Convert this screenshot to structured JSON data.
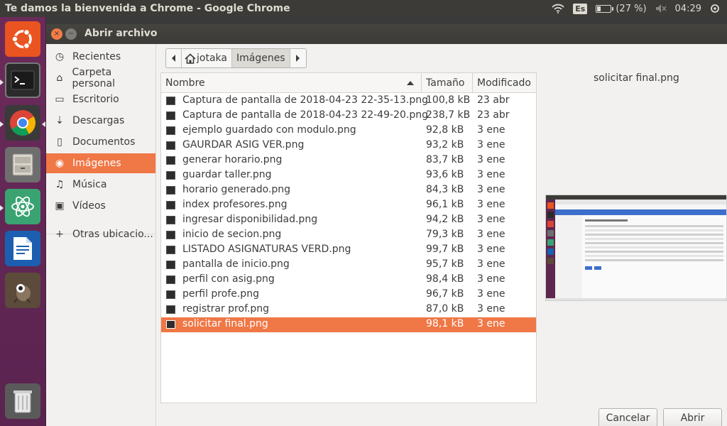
{
  "topbar": {
    "window_title": "Te damos la bienvenida a Chrome - Google Chrome",
    "keyboard_layout": "Es",
    "battery_text": "(27 %)",
    "battery_level": 0.27,
    "clock": "04:29"
  },
  "launcher": {
    "apps": [
      "ubuntu-dash",
      "terminal",
      "chrome",
      "files",
      "atom",
      "libreoffice-writer",
      "gimp",
      "trash"
    ]
  },
  "dialog": {
    "title": "Abrir archivo",
    "close_icon": "×",
    "minimize_icon": "−",
    "sidebar": [
      {
        "icon": "clock-icon",
        "glyph": "◷",
        "label": "Recientes"
      },
      {
        "icon": "home-icon",
        "glyph": "⌂",
        "label": "Carpeta personal"
      },
      {
        "icon": "folder-icon",
        "glyph": "▭",
        "label": "Escritorio"
      },
      {
        "icon": "download-icon",
        "glyph": "⇣",
        "label": "Descargas"
      },
      {
        "icon": "document-icon",
        "glyph": "▯",
        "label": "Documentos"
      },
      {
        "icon": "camera-icon",
        "glyph": "◉",
        "label": "Imágenes"
      },
      {
        "icon": "music-icon",
        "glyph": "♫",
        "label": "Música"
      },
      {
        "icon": "video-icon",
        "glyph": "▣",
        "label": "Vídeos"
      },
      {
        "icon": "plus-icon",
        "glyph": "+",
        "label": "Otras ubicacio..."
      }
    ],
    "active_sidebar": "Imágenes",
    "pathbar": {
      "segments": [
        "jotaka",
        "Imágenes"
      ]
    },
    "columns": {
      "name": "Nombre",
      "size": "Tamaño",
      "modified": "Modificado"
    },
    "files": [
      {
        "name": "Captura de pantalla de 2018-04-23 22-35-13.png",
        "size": "100,8 kB",
        "modified": "23 abr"
      },
      {
        "name": "Captura de pantalla de 2018-04-23 22-49-20.png",
        "size": "238,7 kB",
        "modified": "23 abr"
      },
      {
        "name": "ejemplo guardado con modulo.png",
        "size": "92,8 kB",
        "modified": "3 ene"
      },
      {
        "name": "GAURDAR ASIG VER.png",
        "size": "93,2 kB",
        "modified": "3 ene"
      },
      {
        "name": "generar horario.png",
        "size": "83,7 kB",
        "modified": "3 ene"
      },
      {
        "name": "guardar taller.png",
        "size": "93,6 kB",
        "modified": "3 ene"
      },
      {
        "name": "horario generado.png",
        "size": "84,3 kB",
        "modified": "3 ene"
      },
      {
        "name": "index profesores.png",
        "size": "96,1 kB",
        "modified": "3 ene"
      },
      {
        "name": "ingresar disponibilidad.png",
        "size": "94,2 kB",
        "modified": "3 ene"
      },
      {
        "name": "inicio de secion.png",
        "size": "79,3 kB",
        "modified": "3 ene"
      },
      {
        "name": "LISTADO ASIGNATURAS VERD.png",
        "size": "99,7 kB",
        "modified": "3 ene"
      },
      {
        "name": "pantalla de inicio.png",
        "size": "95,7 kB",
        "modified": "3 ene"
      },
      {
        "name": "perfil con asig.png",
        "size": "98,4 kB",
        "modified": "3 ene"
      },
      {
        "name": "perfil profe.png",
        "size": "96,7 kB",
        "modified": "3 ene"
      },
      {
        "name": "registrar prof.png",
        "size": "87,0 kB",
        "modified": "3 ene"
      },
      {
        "name": "solicitar final.png",
        "size": "98,1 kB",
        "modified": "3 ene"
      }
    ],
    "selected_file": "solicitar final.png",
    "preview_title": "solicitar final.png",
    "buttons": {
      "cancel": "Cancelar",
      "open": "Abrir"
    }
  },
  "colors": {
    "accent": "#f07746",
    "launcher": "#5e2750",
    "panel": "#3c3b37"
  }
}
